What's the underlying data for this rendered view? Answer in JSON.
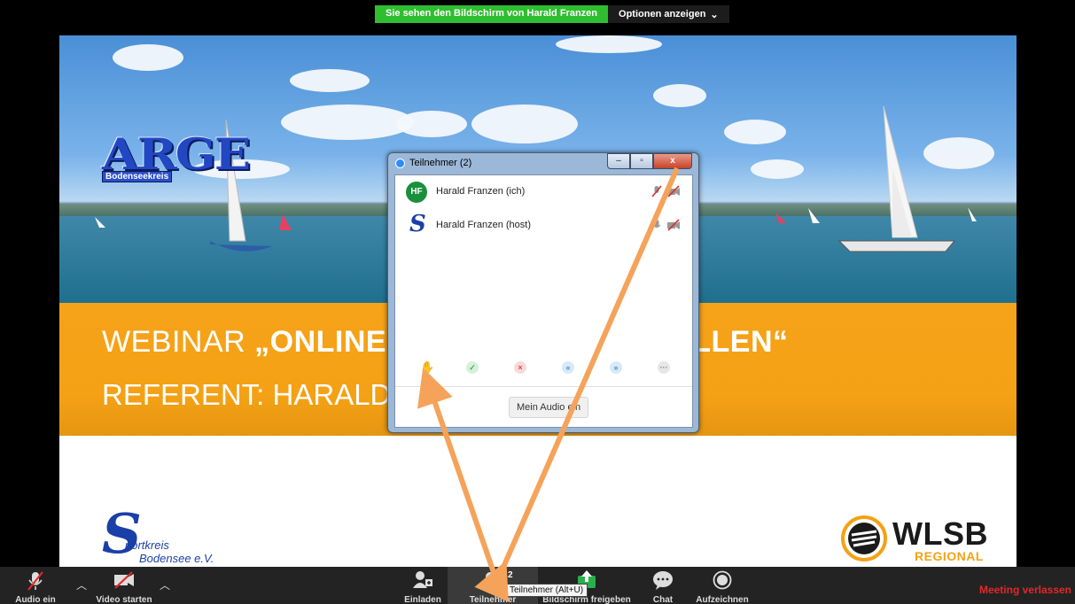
{
  "share_banner": {
    "viewing_text": "Sie sehen den Bildschirm von Harald Franzen",
    "options_label": "Optionen anzeigen"
  },
  "slide": {
    "logo_arge": "ARGE",
    "logo_arge_sub": "Bodenseekreis",
    "title_prefix": "WEBINAR ",
    "title_bold_left": "„ONLINE",
    "title_bold_right": "ELLEN“",
    "referent_text": "REFERENT: HARALD",
    "logo_sk_letter": "S",
    "logo_sk_line1": "portkreis",
    "logo_sk_line2": "Bodensee e.V.",
    "logo_wlsb": "WLSB",
    "logo_wlsb_sub": "REGIONAL"
  },
  "participants_panel": {
    "title": "Teilnehmer (2)",
    "window_buttons": {
      "minimize": "–",
      "maximize": "▫",
      "close": "x"
    },
    "participants": [
      {
        "avatar": "HF",
        "name": "Harald Franzen (ich)"
      },
      {
        "avatar": "S",
        "name": "Harald Franzen (host)"
      }
    ],
    "reactions": [
      {
        "name": "raise-hand",
        "glyph": "✋",
        "color": "#f0a060"
      },
      {
        "name": "yes",
        "glyph": "✓",
        "color": "#3cb54a"
      },
      {
        "name": "no",
        "glyph": "×",
        "color": "#e24545"
      },
      {
        "name": "slower",
        "glyph": "«",
        "color": "#3a8fd6"
      },
      {
        "name": "faster",
        "glyph": "»",
        "color": "#3a8fd6"
      },
      {
        "name": "more",
        "glyph": "···",
        "color": "#888888"
      }
    ],
    "audio_button": "Mein Audio ein"
  },
  "toolbar": {
    "audio": "Audio ein",
    "video": "Video starten",
    "invite": "Einladen",
    "participants": "Teilnehmer",
    "participants_count": "2",
    "share": "Bildschirm freigeben",
    "chat": "Chat",
    "record": "Aufzeichnen",
    "leave": "Meeting verlassen",
    "tooltip": "Teilnehmer (Alt+U)"
  },
  "colors": {
    "accent_orange": "#f4a115",
    "arrow": "#f5a35a",
    "leave_red": "#e22828",
    "banner_green": "#2fbe2f"
  }
}
